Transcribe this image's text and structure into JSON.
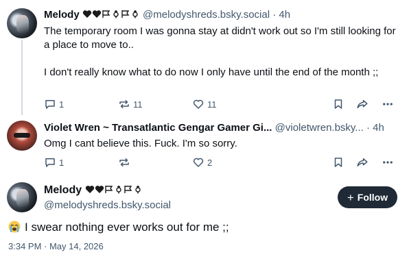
{
  "post1": {
    "display_name": "Melody",
    "handle": "@melodyshreds.bsky.social",
    "separator": "·",
    "time": "4h",
    "paragraph1": "The temporary room I was gonna stay at didn't work out so I'm still looking for a place to move to..",
    "paragraph2": "I don't really know what to do now I only have until the end of the month ;;",
    "replies": "1",
    "reposts": "11",
    "likes": "11"
  },
  "post2": {
    "display_name": "Violet Wren ~ Transatlantic Gengar Gamer Gi...",
    "handle": "@violetwren.bsky...",
    "separator": "·",
    "time": "4h",
    "text": "Omg I cant believe this. Fuck. I'm so sorry.",
    "replies": "1",
    "reposts": "",
    "likes": "2"
  },
  "main_post": {
    "display_name": "Melody",
    "handle": "@melodyshreds.bsky.social",
    "follow_label": "Follow",
    "text": "I swear nothing ever works out for me ;;",
    "timestamp": "3:34 PM · May 14, 2026"
  },
  "colors": {
    "text": "#0b0f14",
    "muted": "#42576c",
    "follow_bg": "#1f2a36"
  },
  "icons": [
    "reply-icon",
    "repost-icon",
    "like-icon",
    "bookmark-icon",
    "share-icon",
    "more-icon",
    "plus-icon",
    "crying-face-emoji"
  ]
}
